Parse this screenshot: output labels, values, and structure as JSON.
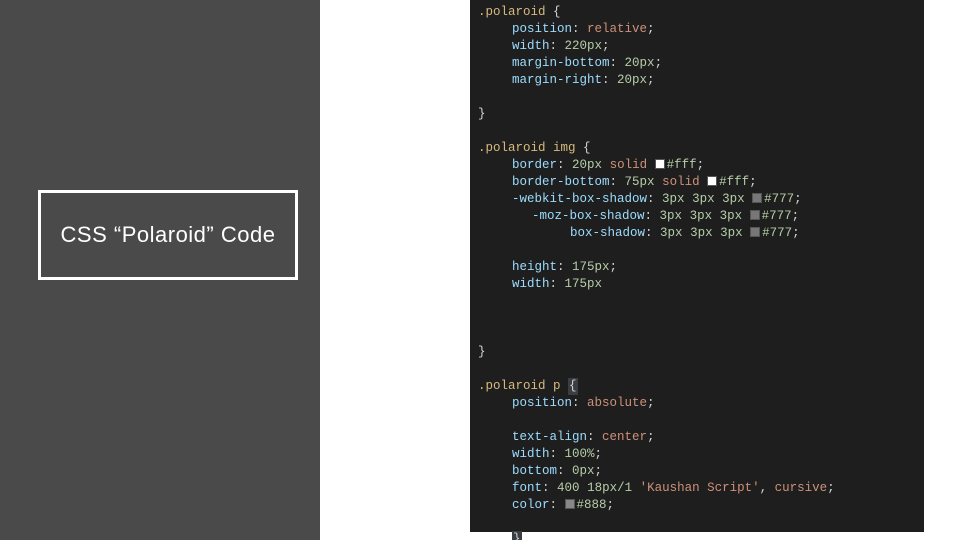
{
  "title": "CSS “Polaroid” Code",
  "code": {
    "rule1": {
      "selector": ".polaroid",
      "props": {
        "position": {
          "k": "position",
          "v": "relative"
        },
        "width": {
          "k": "width",
          "v": "220px"
        },
        "marginBottom": {
          "k": "margin-bottom",
          "v": "20px"
        },
        "marginRight": {
          "k": "margin-right",
          "v": "20px"
        }
      }
    },
    "rule2": {
      "selector": ".polaroid img",
      "props": {
        "border": {
          "k": "border",
          "px": "20px",
          "style": "solid",
          "color": "#fff"
        },
        "borderBottom": {
          "k": "border-bottom",
          "px": "75px",
          "style": "solid",
          "color": "#fff"
        },
        "webkitShadow": {
          "k": "-webkit-box-shadow",
          "a": "3px",
          "b": "3px",
          "c": "3px",
          "color": "#777"
        },
        "mozShadow": {
          "k": "-moz-box-shadow",
          "a": "3px",
          "b": "3px",
          "c": "3px",
          "color": "#777"
        },
        "boxShadow": {
          "k": "box-shadow",
          "a": "3px",
          "b": "3px",
          "c": "3px",
          "color": "#777"
        },
        "height": {
          "k": "height",
          "v": "175px"
        },
        "width": {
          "k": "width",
          "v": "175px"
        }
      }
    },
    "rule3": {
      "selector": ".polaroid p",
      "props": {
        "position": {
          "k": "position",
          "v": "absolute"
        },
        "textAlign": {
          "k": "text-align",
          "v": "center"
        },
        "width": {
          "k": "width",
          "v": "100%"
        },
        "bottom": {
          "k": "bottom",
          "v": "0px"
        },
        "font": {
          "k": "font",
          "weight": "400",
          "size": "18px/1",
          "family1": "'Kaushan Script'",
          "family2": "cursive"
        },
        "color": {
          "k": "color",
          "v": "#888"
        }
      }
    }
  }
}
